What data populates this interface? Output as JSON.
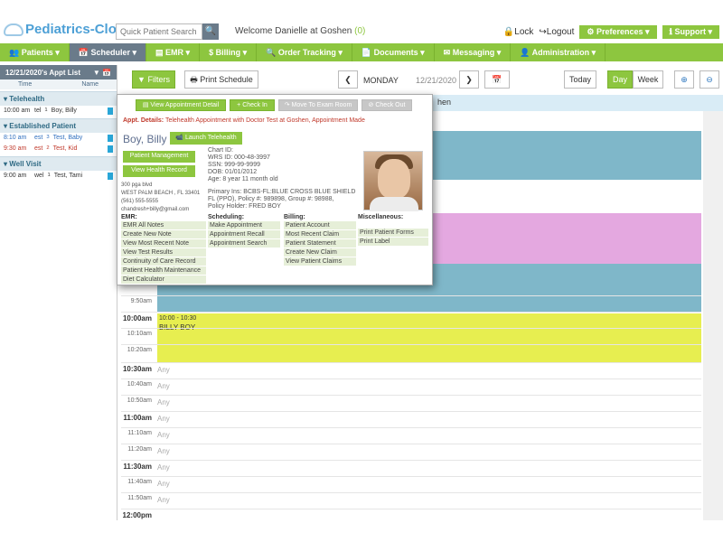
{
  "header": {
    "brand": "Pediatrics-Cloud",
    "search_placeholder": "Quick Patient Search",
    "welcome_prefix": "Welcome Danielle at Goshen",
    "welcome_count": "(0)",
    "lock": "Lock",
    "logout": "Logout",
    "preferences": "Preferences",
    "support": "Support"
  },
  "nav": {
    "items": [
      "Patients",
      "Scheduler",
      "EMR",
      "Billing",
      "Order Tracking",
      "Documents",
      "Messaging",
      "Administration"
    ]
  },
  "left_panel": {
    "title": "12/21/2020's Appt List",
    "col_time": "Time",
    "col_name": "Name",
    "groups": [
      {
        "name": "Telehealth",
        "rows": [
          {
            "time": "10:00 am",
            "code": "tel",
            "sup": "1",
            "name": "Boy, Billy"
          }
        ]
      },
      {
        "name": "Established Patient",
        "rows": [
          {
            "time": "8:10 am",
            "code": "est",
            "sup": "3",
            "name": "Test, Baby"
          },
          {
            "time": "9:30 am",
            "code": "est",
            "sup": "2",
            "name": "Test, Kid"
          }
        ]
      },
      {
        "name": "Well Visit",
        "rows": [
          {
            "time": "9:00 am",
            "code": "wel",
            "sup": "1",
            "name": "Test, Tami"
          }
        ]
      }
    ]
  },
  "toolbar": {
    "filters": "Filters",
    "print_schedule": "Print Schedule",
    "day_label": "MONDAY",
    "date": "12/21/2020",
    "today": "Today",
    "day": "Day",
    "week": "Week"
  },
  "calendar": {
    "header_text": "hen",
    "slots": [
      {
        "label": "9:50am",
        "hour": false,
        "any": ""
      },
      {
        "label": "10:00am",
        "hour": true,
        "any": ""
      },
      {
        "label": "10:10am",
        "hour": false,
        "any": ""
      },
      {
        "label": "10:20am",
        "hour": false,
        "any": ""
      },
      {
        "label": "10:30am",
        "hour": true,
        "any": "Any"
      },
      {
        "label": "10:40am",
        "hour": false,
        "any": "Any"
      },
      {
        "label": "10:50am",
        "hour": false,
        "any": "Any"
      },
      {
        "label": "11:00am",
        "hour": true,
        "any": "Any"
      },
      {
        "label": "11:10am",
        "hour": false,
        "any": "Any"
      },
      {
        "label": "11:20am",
        "hour": false,
        "any": "Any"
      },
      {
        "label": "11:30am",
        "hour": true,
        "any": "Any"
      },
      {
        "label": "11:40am",
        "hour": false,
        "any": "Any"
      },
      {
        "label": "11:50am",
        "hour": false,
        "any": "Any"
      },
      {
        "label": "12:00pm",
        "hour": true,
        "any": ""
      }
    ],
    "appointment": {
      "time": "10:00 - 10:30",
      "name": "BILLY BOY"
    }
  },
  "popup": {
    "buttons": [
      "View Appointment Detail",
      "Check In",
      "Move To Exam Room",
      "Check Out"
    ],
    "details_label": "Appt. Details:",
    "details_text": "Telehealth Appointment with Doctor Test at Goshen, Appointment Made",
    "patient_name": "Boy, Billy",
    "launch_telehealth": "Launch Telehealth",
    "patient_management": "Patient Management",
    "view_health_record": "View Health Record",
    "address": [
      "300 pga blvd",
      "WEST PALM BEACH , FL 33401",
      "(561) 555-5555",
      "chandresh+billy@gmail.com"
    ],
    "chart_id": "Chart ID:",
    "wrs_id": "WRS ID: 000-48-3997",
    "ssn": "SSN: 999-99-9999",
    "dob": "DOB: 01/01/2012",
    "age": "Age: 8 year 11 month old",
    "insurance_lines": [
      "Primary Ins: BCBS-FL:BLUE CROSS BLUE SHIELD",
      "FL (PPO), Policy #: 989898, Group #: 98988,",
      "Policy Holder: FRED BOY"
    ],
    "emr": {
      "head": "EMR:",
      "items": [
        "EMR All Notes",
        "Create New Note",
        "View Most Recent Note",
        "View Test Results",
        "Continuity of Care Record",
        "Patient Health Maintenance",
        "Diet Calculator"
      ]
    },
    "scheduling": {
      "head": "Scheduling:",
      "items": [
        "Make Appointment",
        "Appointment Recall",
        "Appointment Search"
      ]
    },
    "billing": {
      "head": "Billing:",
      "items": [
        "Patient Account",
        "Most Recent Claim",
        "Patient Statement",
        "Create New Claim",
        "View Patient Claims"
      ]
    },
    "misc": {
      "head": "Miscellaneous:",
      "items": [
        "Print Patient Forms",
        "Print Label"
      ]
    }
  },
  "colors": {
    "accent": "#8dc63f",
    "slate": "#6a7b8a",
    "teal_appt": "#7fb7c9",
    "pink_appt": "#e4a8e0",
    "yellow_appt": "#e7ee50"
  }
}
